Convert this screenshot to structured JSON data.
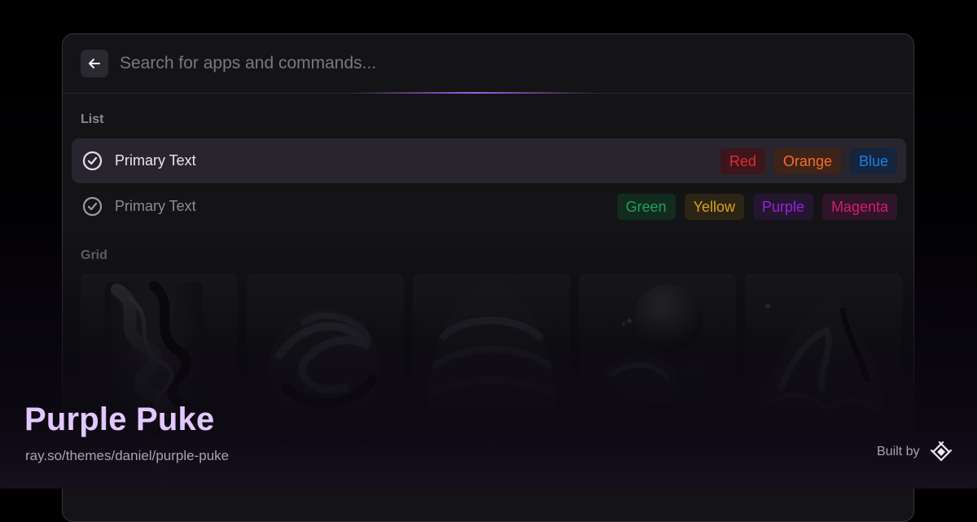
{
  "search": {
    "placeholder": "Search for apps and commands...",
    "back_icon": "arrow-left-icon"
  },
  "list": {
    "title": "List",
    "items": [
      {
        "text": "Primary Text",
        "icon": "check-circle-icon",
        "selected": true,
        "tags": [
          {
            "label": "Red",
            "color": "#e02b34",
            "bg": "#3d161b"
          },
          {
            "label": "Orange",
            "color": "#f37022",
            "bg": "#3e2318"
          },
          {
            "label": "Blue",
            "color": "#1d7fe5",
            "bg": "#14253d"
          }
        ]
      },
      {
        "text": "Primary Text",
        "icon": "check-circle-icon",
        "selected": false,
        "tags": [
          {
            "label": "Green",
            "color": "#1ea35a",
            "bg": "#132a1e"
          },
          {
            "label": "Yellow",
            "color": "#d9a21b",
            "bg": "#2c2414"
          },
          {
            "label": "Purple",
            "color": "#9823d8",
            "bg": "#241530"
          },
          {
            "label": "Magenta",
            "color": "#d31e6e",
            "bg": "#30142a"
          }
        ]
      }
    ]
  },
  "grid": {
    "title": "Grid",
    "items": [
      {
        "name": "wavy-relief-sculpture"
      },
      {
        "name": "swirl-shell-sculpture"
      },
      {
        "name": "half-dome-sculpture"
      },
      {
        "name": "sphere-cluster-sculpture"
      },
      {
        "name": "rocky-peak-sculpture"
      }
    ]
  },
  "footer": {
    "theme_name": "Purple Puke",
    "theme_url": "ray.so/themes/daniel/purple-puke",
    "built_by_label": "Built by",
    "logo_icon": "raycast-logo-icon"
  },
  "colors": {
    "accent": "#a15ee4",
    "title": "#e3c8ff",
    "window_bg": "#141316",
    "selected_row_bg": "#29252e"
  }
}
